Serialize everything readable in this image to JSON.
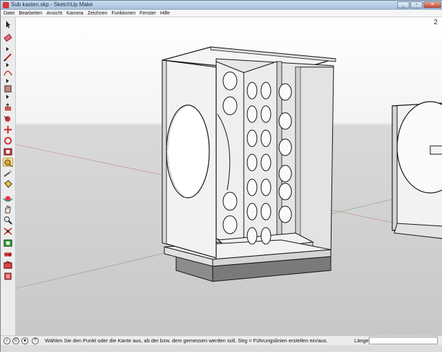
{
  "window": {
    "title": "Sub kasten.skp - SketchUp Make"
  },
  "menubar": {
    "items": [
      "Datei",
      "Bearbeiten",
      "Ansicht",
      "Kamera",
      "Zeichnen",
      "Funktionen",
      "Fenster",
      "Hilfe"
    ]
  },
  "toolbar": {
    "tools": [
      {
        "name": "select-tool-icon"
      },
      {
        "name": "eraser-tool-icon"
      },
      {
        "name": "pencil-line-tool-icon"
      },
      {
        "name": "arc-tool-icon"
      },
      {
        "name": "rectangle-tool-icon"
      },
      {
        "name": "pushpull-tool-icon"
      },
      {
        "name": "followme-tool-icon"
      },
      {
        "name": "move-tool-icon"
      },
      {
        "name": "rotate-tool-icon"
      },
      {
        "name": "scale-tool-icon"
      },
      {
        "name": "offset-tool-icon"
      },
      {
        "name": "tape-measure-tool-icon"
      },
      {
        "name": "text-tool-icon"
      },
      {
        "name": "paint-bucket-tool-icon"
      },
      {
        "name": "orbit-tool-icon"
      },
      {
        "name": "pan-tool-icon"
      },
      {
        "name": "zoom-tool-icon"
      },
      {
        "name": "zoom-extents-tool-icon"
      },
      {
        "name": "warehouse-icon"
      },
      {
        "name": "extension-icon"
      },
      {
        "name": "share-model-icon"
      },
      {
        "name": "layout-icon"
      }
    ]
  },
  "viewport": {
    "corner_label": "2"
  },
  "statusbar": {
    "text": "Wählen Sie den Punkt oder die Kante aus, ab der bzw. dem gemessen werden soll.  Strg = Führungslinien erstellen ein/aus.",
    "length_label": "Länge",
    "length_value": ""
  },
  "colors": {
    "accent": "#d33333",
    "sky": "#ffffff",
    "ground": "#cccccc",
    "model_face": "#f2f2f2",
    "model_shade": "#d6d6d6"
  }
}
